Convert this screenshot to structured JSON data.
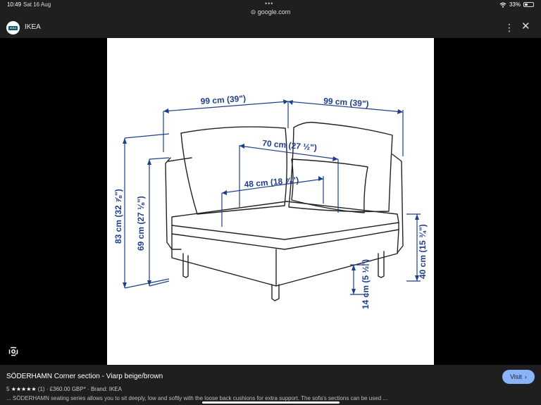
{
  "status": {
    "time": "10:49",
    "date": "Sat 16 Aug",
    "dots": "•••",
    "url": "google.com",
    "battery_percent": "33%",
    "battery_level": 0.33
  },
  "header": {
    "site_name": "IKEA",
    "logo_text": "IKEA",
    "menu_icon": "more-vertical-icon",
    "close_icon": "close-icon"
  },
  "image": {
    "dim_width_left": "99 cm (39\")",
    "dim_width_right": "99 cm (39\")",
    "dim_back_depth": "70 cm (27 ½\")",
    "dim_seat_depth": "48 cm (18 ⅞\")",
    "dim_height_total": "83 cm (32 ⅞\")",
    "dim_height_back": "69 cm (27 ⅛\")",
    "dim_leg_height": "14 cm (5 ½\")",
    "dim_seat_height": "40 cm (15 ¾\")"
  },
  "product": {
    "title": "SÖDERHAMN Corner section - Viarp beige/brown",
    "rating": "5",
    "stars": "★★★★★",
    "reviews": "(1)",
    "price": "£360.00 GBP*",
    "brand": "Brand: IKEA",
    "description": "... SÖDERHAMN seating series allows you to sit deeply, low and softly with the loose back cushions for extra support. The sofa's sections can be used ...",
    "visit_label": "Visit"
  },
  "colors": {
    "chrome": "#1f1f1f",
    "accent": "#8ab4f8",
    "dimension_blue": "#1f3f8a"
  }
}
